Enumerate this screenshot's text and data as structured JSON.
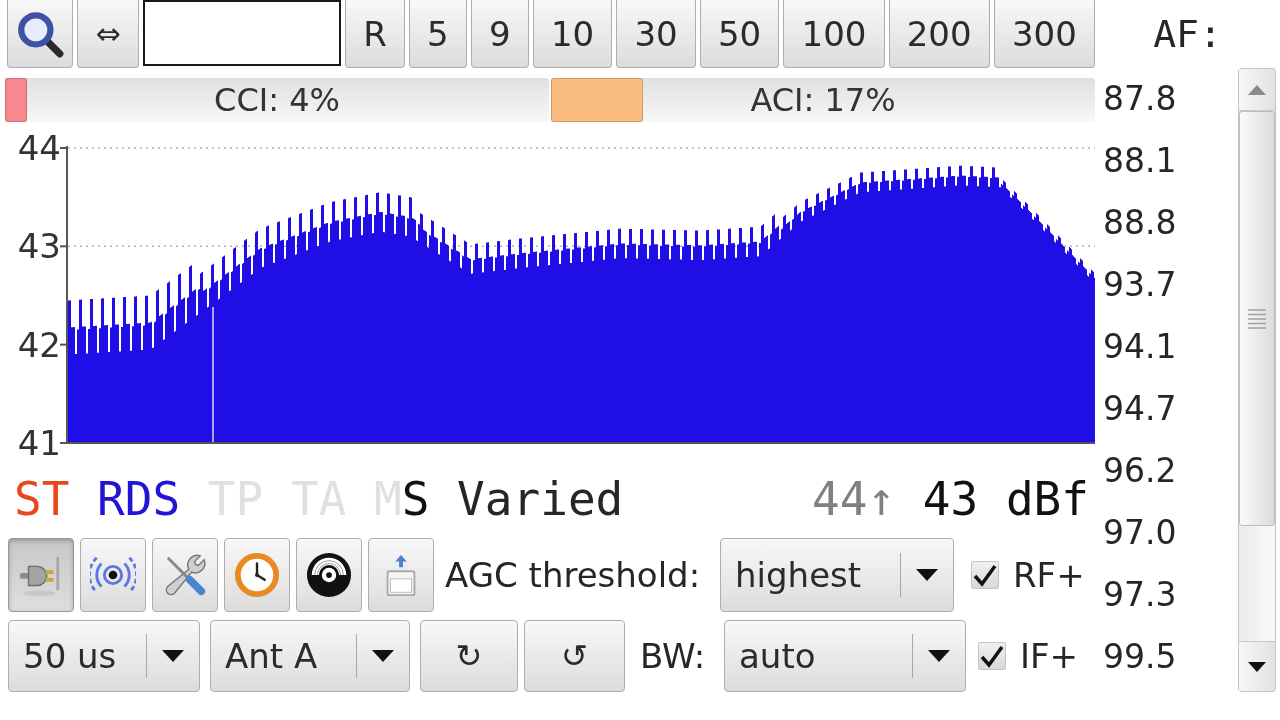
{
  "toolbar": {
    "swap_button": "⇔",
    "step_buttons": [
      "R",
      "5",
      "9",
      "10",
      "30",
      "50",
      "100",
      "200",
      "300"
    ]
  },
  "af_heading": "AF:",
  "interference_meters": [
    {
      "label": "CCI: 4%",
      "level": 0.04,
      "color": "#f6898d"
    },
    {
      "label": "ACI: 17%",
      "level": 0.17,
      "color": "#f9bd80"
    }
  ],
  "signal_graph": {
    "y_axis_labels": [
      "44",
      "43",
      "42",
      "41"
    ]
  },
  "af_list": [
    "87.8",
    "88.1",
    "88.8",
    "93.7",
    "94.1",
    "94.7",
    "96.2",
    "97.0",
    "97.3",
    "99.5"
  ],
  "status": {
    "flags": [
      {
        "label": "ST",
        "on": true,
        "color": "#e8471c"
      },
      {
        "label": "RDS",
        "on": true,
        "color": "#2214d4"
      },
      {
        "label": "TP",
        "on": false
      },
      {
        "label": "TA",
        "on": false
      }
    ],
    "music_speech": [
      {
        "label": "M",
        "on": false
      },
      {
        "label": "S",
        "on": true
      }
    ],
    "pty": "Varied",
    "max_signal": "44↑",
    "signal": "43 dBf"
  },
  "controls": {
    "toggle_buttons": [
      {
        "pressed": true
      },
      {
        "pressed": false
      },
      {
        "pressed": false
      },
      {
        "pressed": false
      },
      {
        "pressed": false
      },
      {
        "pressed": false
      }
    ],
    "agc": {
      "label": "AGC threshold:",
      "value": "highest"
    },
    "rf_plus": {
      "label": "RF+",
      "checked": true
    },
    "deemphasis": {
      "value": "50 us"
    },
    "antenna": {
      "value": "Ant A"
    },
    "rotate_buttons": [
      "↻",
      "↺"
    ],
    "bandwidth": {
      "label": "BW:",
      "value": "auto"
    },
    "if_plus": {
      "label": "IF+",
      "checked": true
    }
  }
}
